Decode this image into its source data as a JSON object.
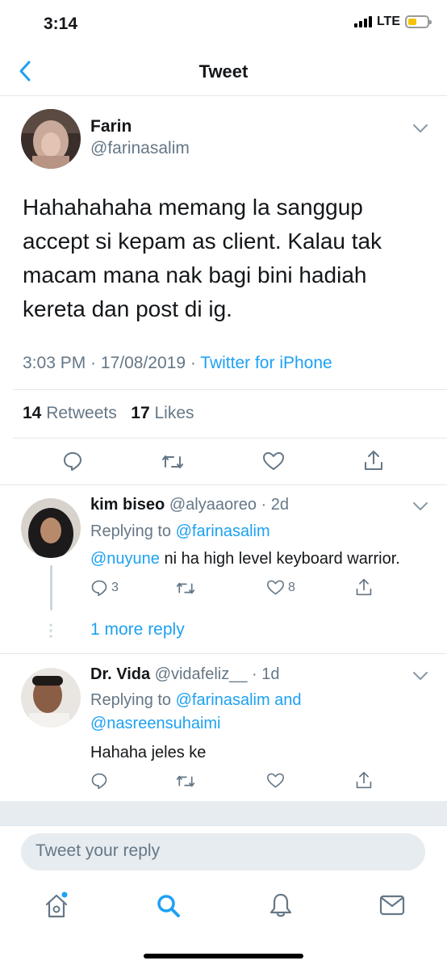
{
  "status": {
    "time": "3:14",
    "network": "LTE",
    "battery_level": 0.45
  },
  "nav": {
    "title": "Tweet"
  },
  "tweet": {
    "author_name": "Farin",
    "handle": "@farinasalim",
    "text": "Hahahahaha memang la sanggup accept si kepam as client. Kalau tak macam mana nak bagi bini hadiah kereta dan post di ig.",
    "time": "3:03 PM",
    "date": "17/08/2019",
    "source": "Twitter for iPhone",
    "retweets_count": "14",
    "retweets_label": "Retweets",
    "likes_count": "17",
    "likes_label": "Likes"
  },
  "replies": [
    {
      "name": "kim biseo",
      "handle": "@alyaaoreo",
      "age": "2d",
      "replying_prefix": "Replying to",
      "replying_to": "@farinasalim",
      "mention": "@nuyune",
      "text": " ni ha high level keyboard warrior.",
      "reply_count": "3",
      "like_count": "8",
      "more_replies": "1 more reply"
    },
    {
      "name": "Dr. Vida",
      "handle": "@vidafeliz__",
      "age": "1d",
      "replying_prefix": "Replying to",
      "replying_to": "@farinasalim and",
      "replying_to_2": "@nasreensuhaimi",
      "text": "Hahaha jeles ke"
    }
  ],
  "composer": {
    "placeholder": "Tweet your reply"
  },
  "tabbar": {
    "items": [
      "home-icon",
      "search-icon",
      "notifications-icon",
      "messages-icon"
    ]
  },
  "colors": {
    "accent": "#1da1f2",
    "muted": "#657786",
    "separator": "#e1e8ed"
  }
}
